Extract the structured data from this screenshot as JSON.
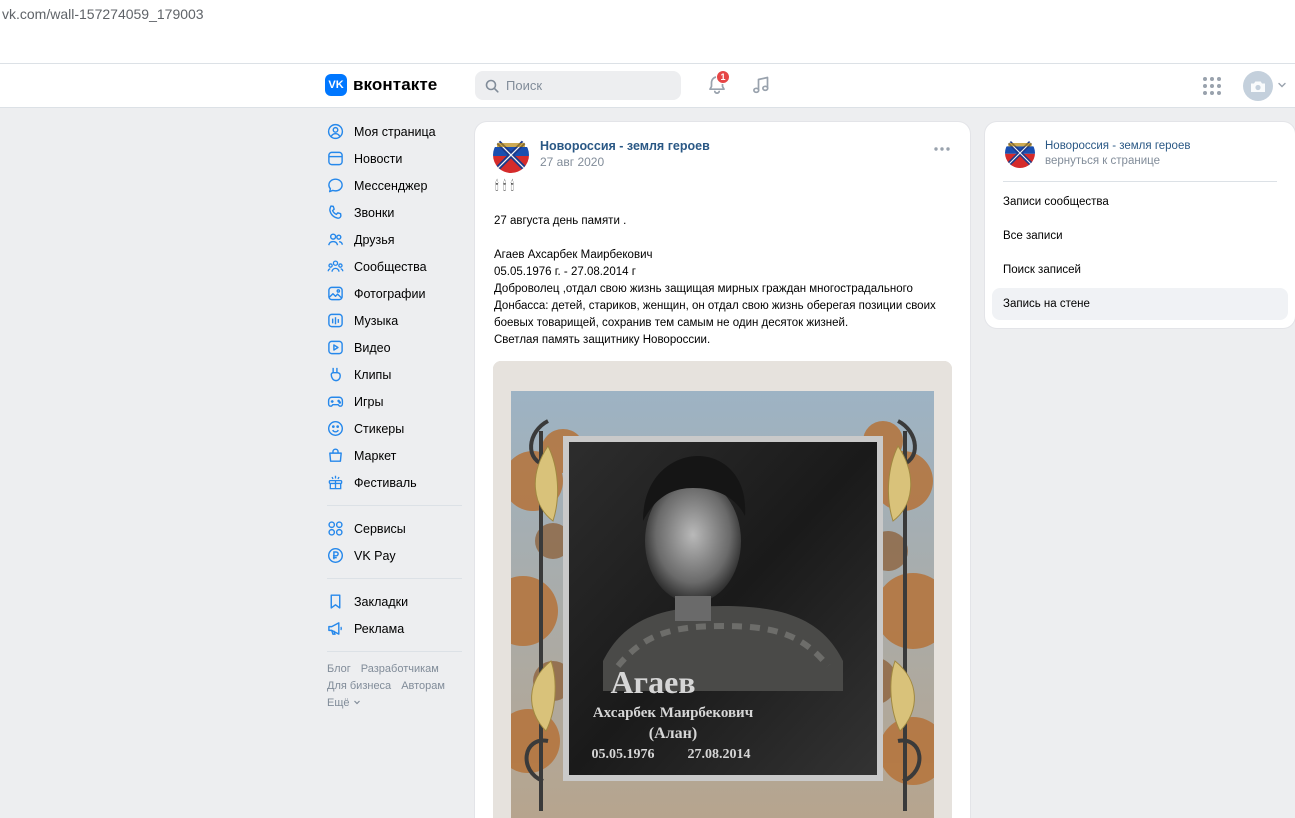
{
  "browser": {
    "url": "vk.com/wall-157274059_179003"
  },
  "header": {
    "logo_text": "вконтакте",
    "logo_mark": "VK",
    "search_placeholder": "Поиск",
    "notifications_count": "1",
    "icons": [
      "search-icon",
      "bell-icon",
      "music-note-icon",
      "apps-grid-icon",
      "camera-icon",
      "chevron-down-icon"
    ]
  },
  "sidebar": {
    "items": [
      {
        "label": "Моя страница",
        "icon": "user-circle-icon"
      },
      {
        "label": "Новости",
        "icon": "newspaper-icon"
      },
      {
        "label": "Мессенджер",
        "icon": "chat-bubble-icon"
      },
      {
        "label": "Звонки",
        "icon": "phone-icon"
      },
      {
        "label": "Друзья",
        "icon": "friends-icon"
      },
      {
        "label": "Сообщества",
        "icon": "communities-icon"
      },
      {
        "label": "Фотографии",
        "icon": "photo-icon"
      },
      {
        "label": "Музыка",
        "icon": "music-icon"
      },
      {
        "label": "Видео",
        "icon": "video-icon"
      },
      {
        "label": "Клипы",
        "icon": "clips-icon"
      },
      {
        "label": "Игры",
        "icon": "gamepad-icon"
      },
      {
        "label": "Стикеры",
        "icon": "smile-icon"
      },
      {
        "label": "Маркет",
        "icon": "shopping-bag-icon"
      },
      {
        "label": "Фестиваль",
        "icon": "festival-icon"
      }
    ],
    "items2": [
      {
        "label": "Сервисы",
        "icon": "services-icon"
      },
      {
        "label": "VK Pay",
        "icon": "ruble-icon"
      }
    ],
    "items3": [
      {
        "label": "Закладки",
        "icon": "bookmark-icon"
      },
      {
        "label": "Реклама",
        "icon": "megaphone-icon"
      }
    ],
    "footer": {
      "blog": "Блог",
      "developers": "Разработчикам",
      "business": "Для бизнеса",
      "authors": "Авторам",
      "more": "Ещё"
    }
  },
  "post": {
    "author": "Новороссия - земля героев",
    "date": "27 авг 2020",
    "emoji": "🕯🕯🕯",
    "lines": [
      "27 августа день памяти .",
      "",
      "Агаев Ахсарбек Маирбекович",
      "05.05.1976 г. - 27.08.2014 г",
      "Доброволец ,отдал свою жизнь защищая мирных граждан многострадального",
      "Донбасса: детей, стариков, женщин, он отдал свою жизнь оберегая позиции своих",
      "боевых товарищей, сохранив тем самым не один десяток жизней.",
      "Светлая память защитнику Новороссии."
    ],
    "photo": {
      "surname": "Агаев",
      "name": "Ахсарбек Маирбекович",
      "nickname": "(Алан)",
      "born": "05.05.1976",
      "died": "27.08.2014"
    }
  },
  "right_panel": {
    "community": "Новороссия - земля героев",
    "back": "вернуться к странице",
    "items": [
      {
        "label": "Записи сообщества",
        "active": false
      },
      {
        "label": "Все записи",
        "active": false
      },
      {
        "label": "Поиск записей",
        "active": false
      },
      {
        "label": "Запись на стене",
        "active": true
      }
    ]
  },
  "colors": {
    "accent": "#0077ff",
    "link": "#2a5885",
    "badge": "#e64646",
    "background": "#edeef0"
  }
}
